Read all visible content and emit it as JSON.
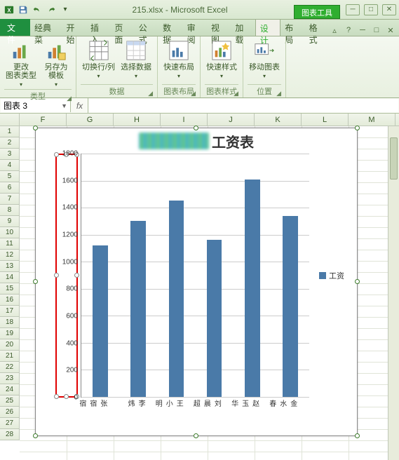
{
  "titlebar": {
    "filename": "215.xlsx",
    "app": "Microsoft Excel",
    "chart_tools": "图表工具"
  },
  "tabs": {
    "file": "文件",
    "items": [
      "经典菜",
      "开始",
      "插入",
      "页面",
      "公式",
      "数据",
      "审阅",
      "视图",
      "加载",
      "设计",
      "布局",
      "格式"
    ],
    "active_index": 9
  },
  "ribbon": {
    "groups": [
      {
        "label": "类型",
        "buttons": [
          {
            "label": "更改\n图表类型",
            "icon": "change-chart-icon"
          },
          {
            "label": "另存为\n模板",
            "icon": "save-template-icon"
          }
        ]
      },
      {
        "label": "数据",
        "buttons": [
          {
            "label": "切换行/列",
            "icon": "switch-rowcol-icon"
          },
          {
            "label": "选择数据",
            "icon": "select-data-icon"
          }
        ]
      },
      {
        "label": "图表布局",
        "buttons": [
          {
            "label": "快速布局",
            "icon": "quick-layout-icon"
          }
        ]
      },
      {
        "label": "图表样式",
        "buttons": [
          {
            "label": "快速样式",
            "icon": "quick-style-icon"
          }
        ]
      },
      {
        "label": "位置",
        "buttons": [
          {
            "label": "移动图表",
            "icon": "move-chart-icon"
          }
        ]
      }
    ]
  },
  "namebox": {
    "value": "图表 3"
  },
  "fx_label": "fx",
  "columns": [
    "F",
    "G",
    "H",
    "I",
    "J",
    "K",
    "L",
    "M"
  ],
  "row_start": 1,
  "row_end": 28,
  "chart": {
    "title_suffix": "工资表",
    "legend_label": "工资"
  },
  "chart_data": {
    "type": "bar",
    "title": "工资表",
    "categories": [
      "张宿宿",
      "李炜",
      "王小明",
      "刘晨超",
      "赵玉华",
      "金水春"
    ],
    "values": [
      1120,
      1300,
      1450,
      1160,
      1610,
      1340
    ],
    "series": [
      {
        "name": "工资",
        "values": [
          1120,
          1300,
          1450,
          1160,
          1610,
          1340
        ]
      }
    ],
    "ylim": [
      0,
      1800
    ],
    "y_ticks": [
      0,
      200,
      400,
      600,
      800,
      1000,
      1200,
      1400,
      1600,
      1800
    ],
    "xlabel": "",
    "ylabel": ""
  }
}
